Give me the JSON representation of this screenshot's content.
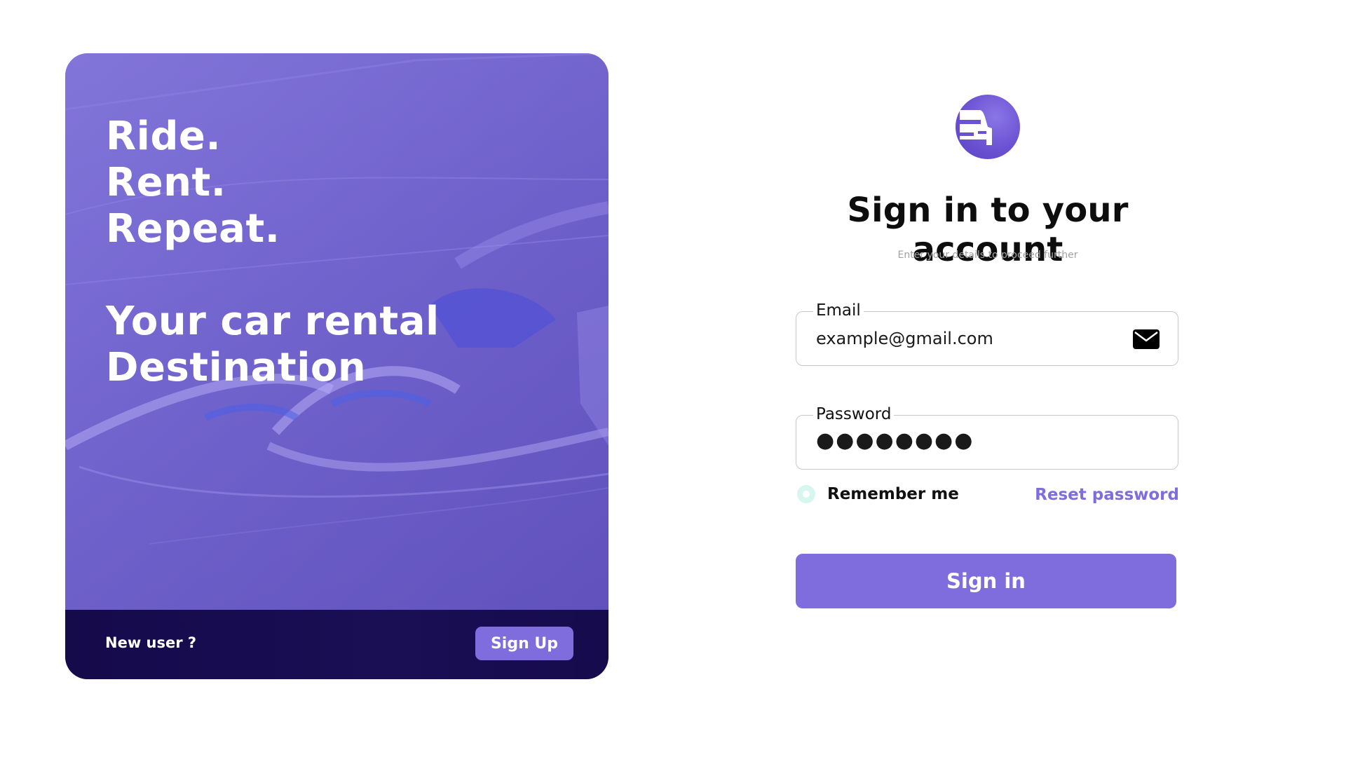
{
  "promo": {
    "headline": [
      "Ride.",
      "Rent.",
      "Repeat."
    ],
    "tagline": [
      "Your car rental",
      "Destination"
    ],
    "footer": {
      "new_user_text": "New user ?",
      "signup_label": "Sign Up"
    }
  },
  "logo": {
    "icon": "car-front-icon"
  },
  "form": {
    "title": "Sign in to your account",
    "subtitle": "Enter your details to proceed further",
    "email": {
      "label": "Email",
      "value": "example@gmail.com",
      "icon": "mail-icon"
    },
    "password": {
      "label": "Password",
      "value": "●●●●●●●●"
    },
    "remember_label": "Remember me",
    "reset_label": "Reset password",
    "submit_label": "Sign in"
  },
  "colors": {
    "accent": "#7f6ddd",
    "promo_bg": "#6e60cc",
    "footer_bg": "#150a4a",
    "radio_bg": "#d6f6ef"
  }
}
